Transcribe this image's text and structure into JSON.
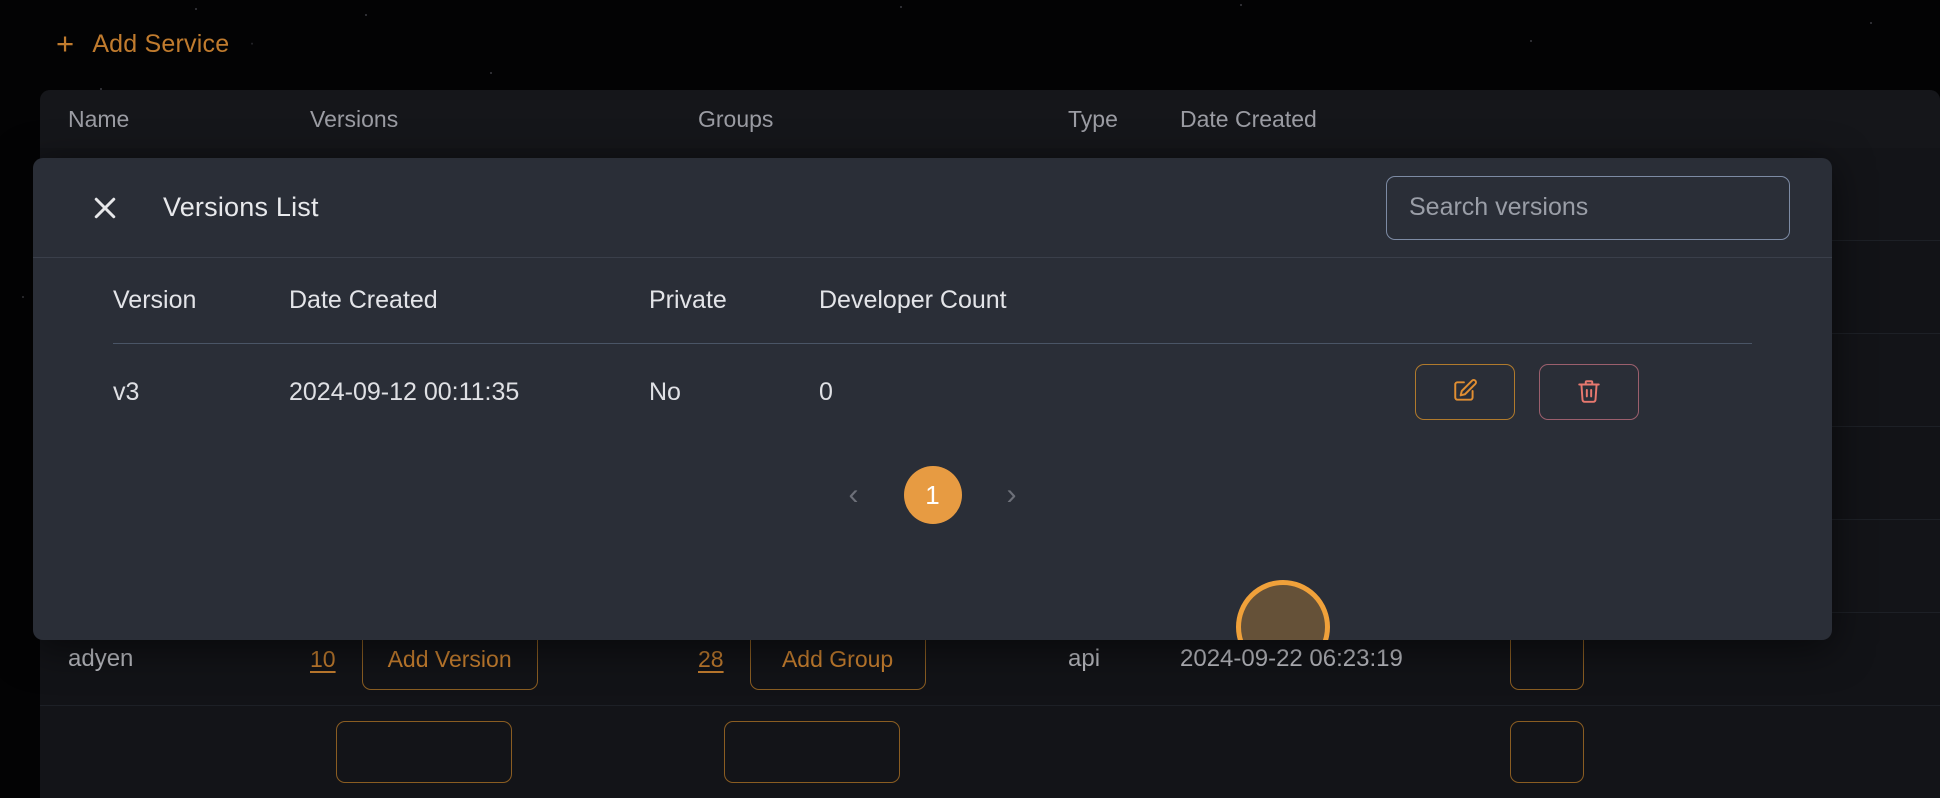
{
  "toolbar": {
    "add_service_label": "Add Service",
    "plus_icon": "plus-icon",
    "caret": "·"
  },
  "background_table": {
    "headers": [
      "Name",
      "Versions",
      "Groups",
      "Type",
      "Date Created"
    ],
    "rows": [
      {
        "name": "",
        "versions_count": "",
        "add_version_label": "",
        "groups_count": "",
        "add_group_label": "",
        "type": "",
        "date_created": ""
      },
      {
        "name": "adyen",
        "versions_count": "10",
        "add_version_label": "Add Version",
        "groups_count": "28",
        "add_group_label": "Add Group",
        "type": "api",
        "date_created": "2024-09-22 06:23:19"
      }
    ]
  },
  "modal": {
    "title": "Versions List",
    "close_icon": "close-icon",
    "search": {
      "placeholder": "Search versions",
      "value": ""
    },
    "table": {
      "headers": [
        "Version",
        "Date Created",
        "Private",
        "Developer Count"
      ],
      "rows": [
        {
          "version": "v3",
          "date_created": "2024-09-12 00:11:35",
          "private": "No",
          "developer_count": "0",
          "edit_icon": "edit-icon",
          "delete_icon": "trash-icon"
        }
      ]
    },
    "pagination": {
      "prev_label": "‹",
      "current_page": "1",
      "next_label": "›"
    }
  },
  "colors": {
    "accent_orange": "#e79b42",
    "accent_orange_dim": "#c07b2e",
    "danger_red": "#e8786f",
    "modal_bg": "#2a2e37",
    "page_bg": "#030304",
    "table_bg": "#131418",
    "highlight_ring": "#f0a13a"
  }
}
